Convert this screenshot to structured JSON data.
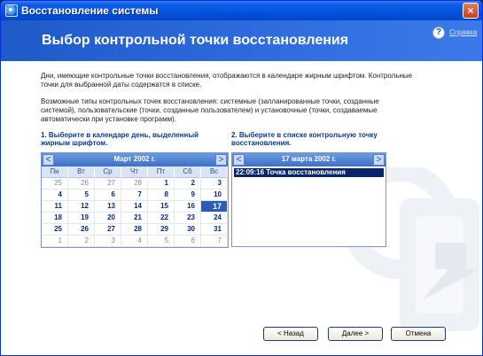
{
  "window": {
    "title": "Восстановление системы",
    "close": "×"
  },
  "header": {
    "heading": "Выбор контрольной точки восстановления",
    "help_icon": "?",
    "help_link": "Справка"
  },
  "intro": {
    "para1": "Дни, имеющие контрольные точки восстановления, отображаются в календаре жирным шрифтом. Контрольные точки для выбранной даты содержатся в списке.",
    "para2": "Возможные типы контрольных точек восстановления: системные (запланированные точки, созданные системой), пользовательские (точки, созданные пользователем) и установочные (точки, создаваемые автоматически при установке программ)."
  },
  "steps": {
    "step1": "1. Выберите в календаре день, выделенный жирным шрифтом.",
    "step2": "2. Выберите в списке контрольную точку восстановления."
  },
  "calendar": {
    "month_label": "Март 2002 г.",
    "prev": "<",
    "next": ">",
    "days_of_week": [
      "Пн",
      "Вт",
      "Ср",
      "Чт",
      "Пт",
      "Сб",
      "Вс"
    ],
    "weeks": [
      [
        "25",
        "26",
        "27",
        "28",
        "1",
        "2",
        "3"
      ],
      [
        "4",
        "5",
        "6",
        "7",
        "8",
        "9",
        "10"
      ],
      [
        "11",
        "12",
        "13",
        "14",
        "15",
        "16",
        "17"
      ],
      [
        "18",
        "19",
        "20",
        "21",
        "22",
        "23",
        "24"
      ],
      [
        "25",
        "26",
        "27",
        "28",
        "29",
        "30",
        "31"
      ],
      [
        "1",
        "2",
        "3",
        "4",
        "5",
        "6",
        "7"
      ]
    ],
    "selected_day": "17"
  },
  "restore_list": {
    "date_label": "17 марта 2002 г.",
    "prev": "<",
    "next": ">",
    "items": [
      "22:09:16  Точка восстановления"
    ]
  },
  "buttons": {
    "back": "< Назад",
    "next": "Далее >",
    "cancel": "Отмена"
  },
  "colors": {
    "title_bar": "#0651dd",
    "header": "#2f6ee0",
    "selected": "#2b5cb8",
    "list_selected": "#0a246a"
  }
}
